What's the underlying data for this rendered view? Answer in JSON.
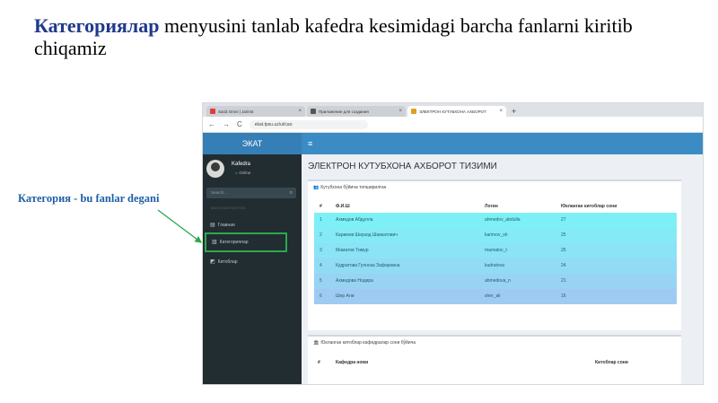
{
  "slide": {
    "title_keyword": "Категориялар",
    "title_rest": " menyusini tanlab kafedra kesimidagi barcha fanlarni kiritib chiqamiz",
    "callout": "Категория - bu fanlar degani"
  },
  "browser": {
    "tabs": [
      {
        "title": "Sardi Omni | Jaririst",
        "fav_color": "#e03c3c",
        "active": false
      },
      {
        "title": "Приложение для создания",
        "fav_color": "#555555",
        "active": false
      },
      {
        "title": "ЭЛЕКТРОН КУТУБХОНА АХБОРОТ",
        "fav_color": "#e0a020",
        "active": true
      }
    ],
    "new_tab": "+",
    "close": "×",
    "back": "←",
    "forward": "→",
    "reload": "C",
    "url": "ekat.tpsu.uz/ui/cao"
  },
  "app": {
    "brand": "ЭКАТ",
    "menu_toggle": "≡",
    "user": {
      "name": "Kafedra",
      "status": "Online"
    },
    "search_placeholder": "Search...",
    "search_icon": "⌕",
    "menu_header": "MAIN NAVIGATION",
    "menu": [
      {
        "icon": "▤",
        "label": "Главная"
      },
      {
        "icon": "▥",
        "label": "Категориялар"
      },
      {
        "icon": "◩",
        "label": "Китоблар"
      }
    ],
    "page_title": "ЭЛЕКТРОН КУТУБХОНА АХБОРОТ ТИЗИМИ",
    "box1": {
      "icon": "👥",
      "title": "Кутубхона бўйича топширилган",
      "columns": [
        "#",
        "Ф.И.Ш",
        "Логин",
        "Юкланган китоблар сони"
      ],
      "rows": [
        {
          "n": "1",
          "fio": "Ахмедов Абдулла",
          "login": "ahmedov_abdulla",
          "count": "27",
          "bg": "#7df0f6"
        },
        {
          "n": "2",
          "fio": "Каримов Шерзод Шавкатович",
          "login": "karimov_sh",
          "count": "25",
          "bg": "#84eaf6"
        },
        {
          "n": "3",
          "fio": "Маматов Тимур",
          "login": "mamatov_t",
          "count": "25",
          "bg": "#8be3f6"
        },
        {
          "n": "4",
          "fio": "Кудратова Гулноза Зафаровна",
          "login": "kudratova",
          "count": "24",
          "bg": "#91dbf5"
        },
        {
          "n": "5",
          "fio": "Ахмедова Нодира",
          "login": "ahmedova_n",
          "count": "21",
          "bg": "#98d3f4"
        },
        {
          "n": "6",
          "fio": "Шер Али",
          "login": "sher_ali",
          "count": "16",
          "bg": "#9fcbf3"
        }
      ]
    },
    "box2": {
      "icon": "🏛",
      "title": "Юкланган китоблар кафедралар сони бўйича",
      "columns": [
        "#",
        "Кафедра номи",
        "Китоблар сони"
      ]
    }
  },
  "colors": {
    "accent": "#3b8bc5",
    "sidebar": "#222d32",
    "highlight": "#2ea84a",
    "title_keyword": "#1f3a8a"
  }
}
